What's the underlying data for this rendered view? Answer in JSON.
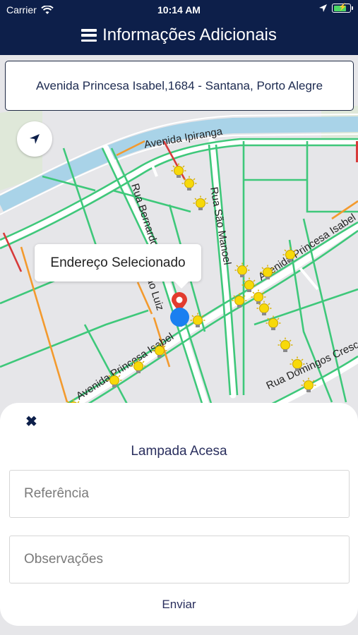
{
  "status_bar": {
    "carrier": "Carrier",
    "time": "10:14 AM",
    "battery_level": 0.85
  },
  "header": {
    "menu_icon": "hamburger-icon",
    "title": "Informações Adicionais"
  },
  "address": {
    "text": "Avenida Princesa Isabel,1684 - Santana, Porto Alegre"
  },
  "map": {
    "locate_icon": "navigation-arrow-icon",
    "callout": "Endereço Selecionado",
    "streets": [
      "Avenida Ipiranga",
      "Rua Bernardo",
      "Rua São Manoel",
      "Avenida Princesa Isabel",
      "Avenida Princesa Isabel",
      "Rua Domingos Cresce",
      "ão Luiz"
    ],
    "colors": {
      "traffic_green": "#3ec87a",
      "traffic_orange": "#f39a2e",
      "traffic_red": "#d73a3a",
      "river": "#a9d3e8",
      "marker_red": "#e23b2e",
      "user_dot": "#1a7ff0"
    }
  },
  "sheet": {
    "close_icon": "close-icon",
    "title": "Lampada Acesa",
    "reference_placeholder": "Referência",
    "notes_placeholder": "Observações",
    "send_label": "Enviar"
  }
}
